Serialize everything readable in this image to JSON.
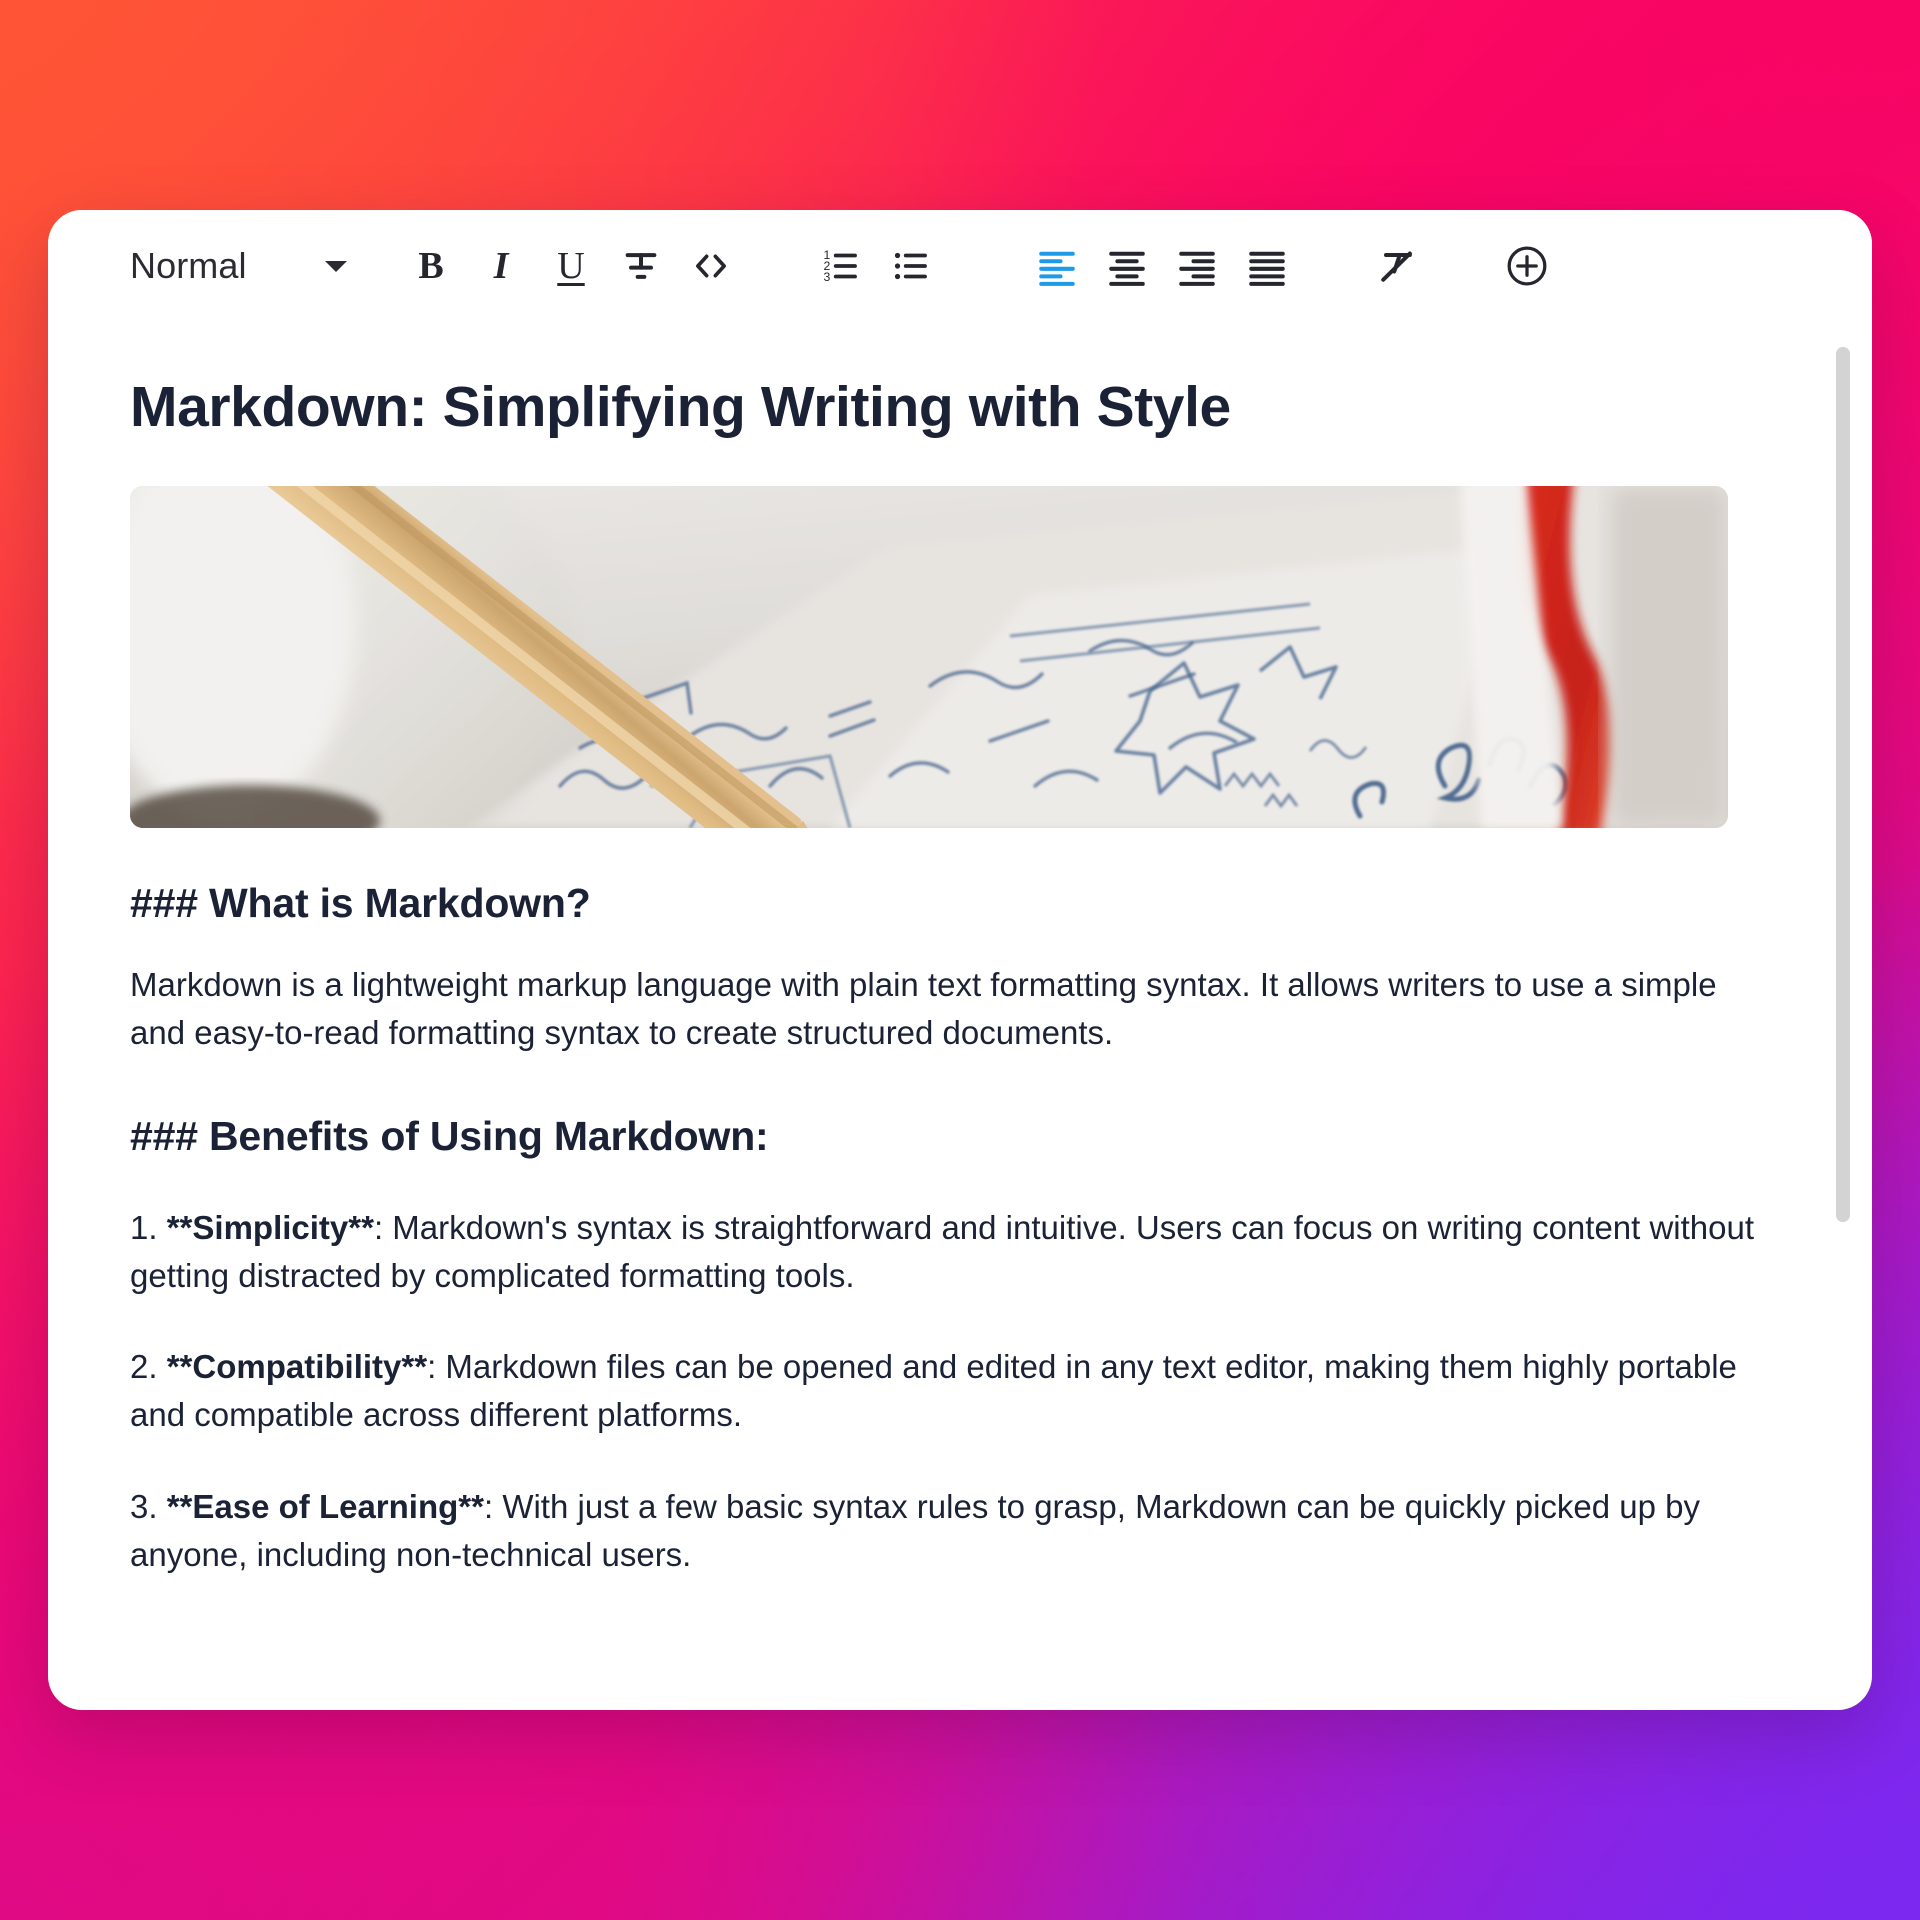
{
  "background": {
    "gradient_colors": [
      "#FF5436",
      "#F90563",
      "#DE0A86",
      "#7C28F0"
    ]
  },
  "toolbar": {
    "format_select": {
      "value": "Normal",
      "chevron_icon": "chevron-down-icon"
    },
    "buttons": [
      {
        "name": "bold-button",
        "label": "B",
        "icon": "bold-icon",
        "active": false
      },
      {
        "name": "italic-button",
        "label": "I",
        "icon": "italic-icon",
        "active": false
      },
      {
        "name": "underline-button",
        "label": "U",
        "icon": "underline-icon",
        "active": false
      },
      {
        "name": "strikethrough-button",
        "label": "",
        "icon": "strikethrough-icon",
        "active": false
      },
      {
        "name": "code-button",
        "label": "<>",
        "icon": "code-icon",
        "active": false
      },
      {
        "name": "ordered-list-button",
        "label": "",
        "icon": "ordered-list-icon",
        "active": false
      },
      {
        "name": "bullet-list-button",
        "label": "",
        "icon": "bullet-list-icon",
        "active": false
      },
      {
        "name": "align-left-button",
        "label": "",
        "icon": "align-left-icon",
        "active": true
      },
      {
        "name": "align-center-button",
        "label": "",
        "icon": "align-center-icon",
        "active": false
      },
      {
        "name": "align-right-button",
        "label": "",
        "icon": "align-right-icon",
        "active": false
      },
      {
        "name": "align-justify-button",
        "label": "",
        "icon": "align-justify-icon",
        "active": false
      },
      {
        "name": "clear-format-button",
        "label": "",
        "icon": "clear-formatting-icon",
        "active": false
      },
      {
        "name": "add-button",
        "label": "",
        "icon": "plus-circle-icon",
        "active": false
      }
    ],
    "active_color": "#1E9AE8",
    "icon_color": "#26262E"
  },
  "document": {
    "title": "Markdown: Simplifying Writing with Style",
    "hero_image_alt": "Pencil resting on an open notebook page filled with blue handwritten notes next to a white mug and a red ribbon bookmark",
    "heading_1": "### What is Markdown?",
    "paragraph_1": "Markdown is a lightweight markup language with plain text formatting syntax. It allows writers to use a simple and easy-to-read formatting syntax to create structured documents.",
    "heading_2": "### Benefits of Using Markdown:",
    "list_items": [
      {
        "number": "1.",
        "term": "**Simplicity**",
        "rest": ": Markdown's syntax is straightforward and intuitive. Users can focus on writing content without getting distracted by complicated formatting tools."
      },
      {
        "number": "2.",
        "term": "**Compatibility**",
        "rest": ": Markdown files can be opened and edited in any text editor, making them highly portable and compatible across different platforms."
      },
      {
        "number": "3.",
        "term": "**Ease of Learning**",
        "rest": ": With just a few basic syntax rules to grasp, Markdown can be quickly picked up by anyone, including non-technical users."
      }
    ]
  },
  "scrollbar": {
    "name": "vertical-scrollbar",
    "thumb_color": "#D3D3D3"
  }
}
